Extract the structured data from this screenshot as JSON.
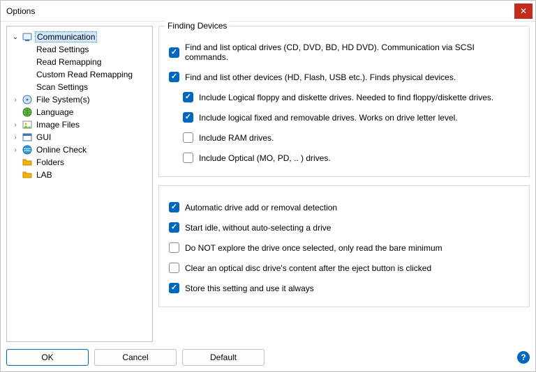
{
  "window": {
    "title": "Options"
  },
  "tree": {
    "communication": {
      "label": "Communication",
      "children": {
        "read_settings": "Read Settings",
        "read_remapping": "Read Remapping",
        "custom_read_remapping": "Custom Read Remapping",
        "scan_settings": "Scan Settings"
      }
    },
    "file_systems": "File System(s)",
    "language": "Language",
    "image_files": "Image Files",
    "gui": "GUI",
    "online_check": "Online Check",
    "folders": "Folders",
    "lab": "LAB"
  },
  "group1": {
    "title": "Finding Devices",
    "opt1": "Find and list optical drives (CD, DVD, BD, HD DVD).  Communication via SCSI commands.",
    "opt2": "Find and list other devices (HD, Flash, USB etc.).  Finds physical devices.",
    "opt3": "Include Logical floppy and diskette drives.  Needed to find floppy/diskette drives.",
    "opt4": "Include logical fixed and removable drives.  Works on drive letter level.",
    "opt5": "Include RAM drives.",
    "opt6": "Include Optical (MO, PD, .. ) drives."
  },
  "group2": {
    "opt1": "Automatic drive add or removal detection",
    "opt2": "Start idle, without auto-selecting a drive",
    "opt3": "Do NOT explore the drive once selected, only read the bare minimum",
    "opt4": "Clear an optical disc drive's content after the eject button is clicked",
    "opt5": "Store this setting and use it always"
  },
  "buttons": {
    "ok": "OK",
    "cancel": "Cancel",
    "default": "Default"
  },
  "checks": {
    "g1o1": true,
    "g1o2": true,
    "g1o3": true,
    "g1o4": true,
    "g1o5": false,
    "g1o6": false,
    "g2o1": true,
    "g2o2": true,
    "g2o3": false,
    "g2o4": false,
    "g2o5": true
  }
}
